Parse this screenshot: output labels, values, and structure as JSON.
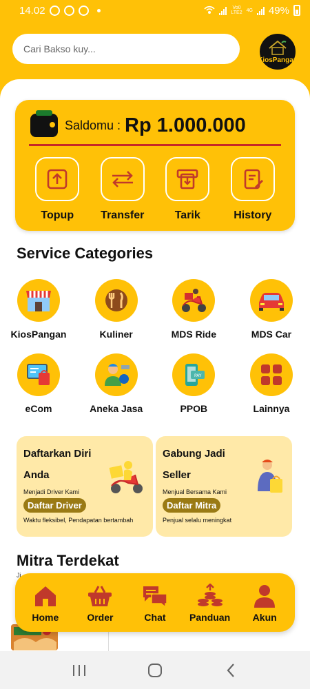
{
  "status_bar": {
    "time": "14.02",
    "battery": "49%",
    "network_top": "Vo0",
    "network_bottom": "LTE2",
    "network_gen": "4G"
  },
  "search": {
    "placeholder": "Cari Bakso kuy..."
  },
  "logo": {
    "text": "KiosPangan"
  },
  "wallet": {
    "label": "Saldomu :",
    "amount": "Rp 1.000.000",
    "actions": [
      {
        "label": "Topup",
        "icon": "topup-icon"
      },
      {
        "label": "Transfer",
        "icon": "transfer-icon"
      },
      {
        "label": "Tarik",
        "icon": "withdraw-icon"
      },
      {
        "label": "History",
        "icon": "history-icon"
      }
    ]
  },
  "services": {
    "title": "Service Categories",
    "items": [
      {
        "label": "KiosPangan",
        "icon": "store-icon"
      },
      {
        "label": "Kuliner",
        "icon": "utensils-icon"
      },
      {
        "label": "MDS Ride",
        "icon": "scooter-icon"
      },
      {
        "label": "MDS Car",
        "icon": "car-icon"
      },
      {
        "label": "eCom",
        "icon": "ecommerce-icon"
      },
      {
        "label": "Aneka Jasa",
        "icon": "service-worker-icon"
      },
      {
        "label": "PPOB",
        "icon": "payment-icon"
      },
      {
        "label": "Lainnya",
        "icon": "grid-icon"
      }
    ]
  },
  "promos": [
    {
      "title_line1": "Daftarkan Diri",
      "title_line2": "Anda",
      "subtitle": "Menjadi Driver Kami",
      "button": "Daftar Driver",
      "note": "Waktu fleksibel, Pendapatan bertambah"
    },
    {
      "title_line1": "Gabung Jadi",
      "title_line2": "Seller",
      "subtitle": "Menjual Bersama Kami",
      "button": "Daftar Mitra",
      "note": "Penjual selalu meningkat"
    }
  ],
  "mitra": {
    "title": "Mitra Terdekat",
    "subtitle": "Ji..."
  },
  "bottom_nav": [
    {
      "label": "Home",
      "icon": "home-icon"
    },
    {
      "label": "Order",
      "icon": "basket-icon"
    },
    {
      "label": "Chat",
      "icon": "chat-icon"
    },
    {
      "label": "Panduan",
      "icon": "guide-icon"
    },
    {
      "label": "Akun",
      "icon": "user-icon"
    }
  ],
  "colors": {
    "primary": "#FFC107",
    "icon_red": "#C0392B",
    "accent_line": "#C62828",
    "promo_bg": "#FFE9A8",
    "promo_button": "#9A7A14"
  }
}
